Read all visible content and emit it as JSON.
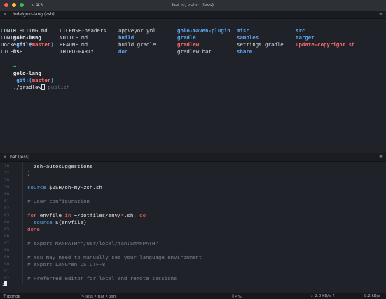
{
  "window": {
    "shortcut": "⌥⌘3",
    "title": "bat ~/.zshrc (less)"
  },
  "pane_top": {
    "title": "../ode/golo-lang (zsh)",
    "prompt": {
      "dir": "golo-lang",
      "git": "git:",
      "paren_open": "(",
      "branch": "master",
      "paren_close": ")"
    },
    "command1": "ls",
    "ls_columns": [
      [
        {
          "name": "CONTRIBUTING.md",
          "kind": "plain"
        },
        {
          "name": "CONTRIBUTORS",
          "kind": "plain"
        },
        {
          "name": "Dockerfile",
          "kind": "plain"
        },
        {
          "name": "LICENSE",
          "kind": "plain"
        }
      ],
      [
        {
          "name": "LICENSE-headers",
          "kind": "plain"
        },
        {
          "name": "NOTICE.md",
          "kind": "plain"
        },
        {
          "name": "README.md",
          "kind": "plain"
        },
        {
          "name": "THIRD-PARTY",
          "kind": "plain"
        }
      ],
      [
        {
          "name": "appveyor.yml",
          "kind": "plain"
        },
        {
          "name": "build",
          "kind": "dir"
        },
        {
          "name": "build.gradle",
          "kind": "plain"
        },
        {
          "name": "doc",
          "kind": "dir"
        }
      ],
      [
        {
          "name": "golo-maven-plugin",
          "kind": "dir"
        },
        {
          "name": "gradle",
          "kind": "dir"
        },
        {
          "name": "gradlew",
          "kind": "exec"
        },
        {
          "name": "gradlew.bat",
          "kind": "plain"
        }
      ],
      [
        {
          "name": "misc",
          "kind": "dir"
        },
        {
          "name": "samples",
          "kind": "dir"
        },
        {
          "name": "settings.gradle",
          "kind": "plain"
        },
        {
          "name": "share",
          "kind": "dir"
        }
      ],
      [
        {
          "name": "src",
          "kind": "dir"
        },
        {
          "name": "target",
          "kind": "dir"
        },
        {
          "name": "update-copyright.sh",
          "kind": "exec"
        }
      ]
    ],
    "command2": "./gradlew",
    "suggestion": " publish"
  },
  "pane_bottom": {
    "title": "bat (less)",
    "lines": [
      {
        "num": "76",
        "parts": [
          {
            "t": "  zsh-autosuggestions",
            "c": "ident"
          }
        ]
      },
      {
        "num": "77",
        "parts": [
          {
            "t": ")",
            "c": "ident"
          }
        ]
      },
      {
        "num": "78",
        "parts": []
      },
      {
        "num": "79",
        "parts": [
          {
            "t": "source",
            "c": "bi"
          },
          {
            "t": " $ZSH/oh-my-zsh.sh",
            "c": "ident"
          }
        ]
      },
      {
        "num": "80",
        "parts": []
      },
      {
        "num": "81",
        "parts": [
          {
            "t": "# User configuration",
            "c": "comment"
          }
        ]
      },
      {
        "num": "82",
        "parts": []
      },
      {
        "num": "83",
        "parts": [
          {
            "t": "for",
            "c": "kw"
          },
          {
            "t": " envfile ",
            "c": "ident"
          },
          {
            "t": "in",
            "c": "kw"
          },
          {
            "t": " ~/dotfiles/env/",
            "c": "ident"
          },
          {
            "t": "*",
            "c": "kw"
          },
          {
            "t": ".sh; ",
            "c": "ident"
          },
          {
            "t": "do",
            "c": "kw"
          }
        ]
      },
      {
        "num": "84",
        "parts": [
          {
            "t": "  source",
            "c": "bi"
          },
          {
            "t": " ${envfile}",
            "c": "ident"
          }
        ]
      },
      {
        "num": "85",
        "parts": [
          {
            "t": "done",
            "c": "kw"
          }
        ]
      },
      {
        "num": "86",
        "parts": []
      },
      {
        "num": "87",
        "parts": [
          {
            "t": "# export MANPATH=\"/usr/local/man:$MANPATH\"",
            "c": "comment"
          }
        ]
      },
      {
        "num": "88",
        "parts": []
      },
      {
        "num": "89",
        "parts": [
          {
            "t": "# You may need to manually set your language environment",
            "c": "comment"
          }
        ]
      },
      {
        "num": "90",
        "parts": [
          {
            "t": "# export LANG=en_US.UTF-8",
            "c": "comment"
          }
        ]
      },
      {
        "num": "91",
        "parts": []
      },
      {
        "num": "92",
        "parts": [
          {
            "t": "# Preferred editor for local and remote sessions",
            "c": "comment"
          }
        ]
      }
    ],
    "less_prompt": ":"
  },
  "statusbar": {
    "user": "jbonge",
    "process": "less ‣ bat ‣ zsh",
    "mem": "4%",
    "net": "↓ 2.0 kB/s ↑",
    "time": "8.2 kB/s"
  },
  "colors": {
    "bg": "#1f2228",
    "prompt_arrow": "#35c98a",
    "dir_blue": "#5ea6f2",
    "exec_red": "#ff6b6b",
    "comment": "#7b8090"
  }
}
